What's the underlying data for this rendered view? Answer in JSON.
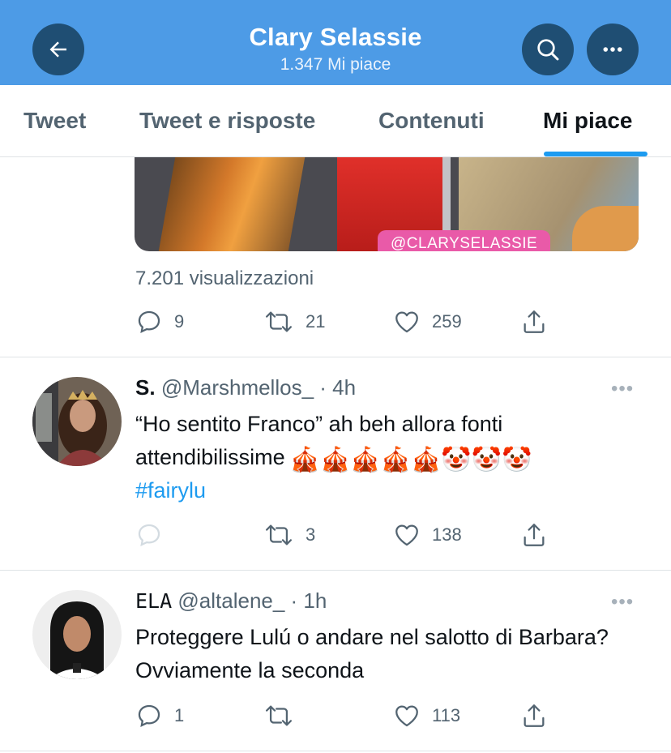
{
  "header": {
    "title": "Clary Selassie",
    "subtitle": "1.347 Mi piace",
    "back_icon": "back-arrow-icon",
    "search_icon": "search-icon",
    "more_icon": "more-icon"
  },
  "tabs": [
    {
      "label": "Tweet"
    },
    {
      "label": "Tweet e risposte"
    },
    {
      "label": "Contenuti"
    },
    {
      "label": "Mi piace",
      "active": true
    }
  ],
  "tweets": [
    {
      "media_watermark": "@CLARYSELASSIE",
      "views": "7.201 visualizzazioni",
      "replies": "9",
      "retweets": "21",
      "likes": "259"
    },
    {
      "name": "S.",
      "handle": "@Marshmellos_",
      "time": " · 4h",
      "text": "“Ho sentito Franco” ah beh allora fonti attendibilissime",
      "emojis": "🎪🎪🎪🎪🎪🤡🤡🤡",
      "hashtag": "#fairylu",
      "replies": "",
      "retweets": "3",
      "likes": "138"
    },
    {
      "name": "ELA",
      "handle": "@altalene_",
      "time": " · 1h",
      "text": "Proteggere Lulú o andare nel salotto di Barbara? Ovviamente la seconda",
      "replies": "1",
      "retweets": "",
      "likes": "113"
    }
  ],
  "colors": {
    "header_bg": "#4d9be6",
    "header_button": "#1f4e73",
    "accent": "#1d9bf0",
    "muted_text": "#536471"
  }
}
